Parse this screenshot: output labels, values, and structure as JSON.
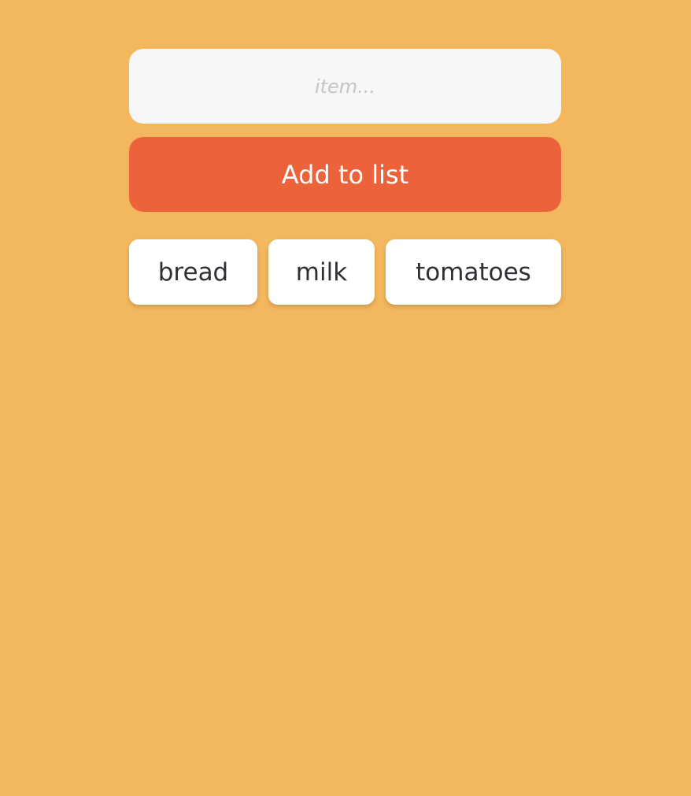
{
  "form": {
    "input_value": "",
    "input_placeholder": "item...",
    "add_button_label": "Add to list"
  },
  "list": {
    "items": [
      {
        "label": "bread"
      },
      {
        "label": "milk"
      },
      {
        "label": "tomatoes"
      }
    ]
  },
  "colors": {
    "background": "#f3b75e",
    "input_background": "#f7f7f7",
    "button_accent": "#ec623a",
    "chip_background": "#ffffff",
    "chip_text": "#2f3035"
  }
}
